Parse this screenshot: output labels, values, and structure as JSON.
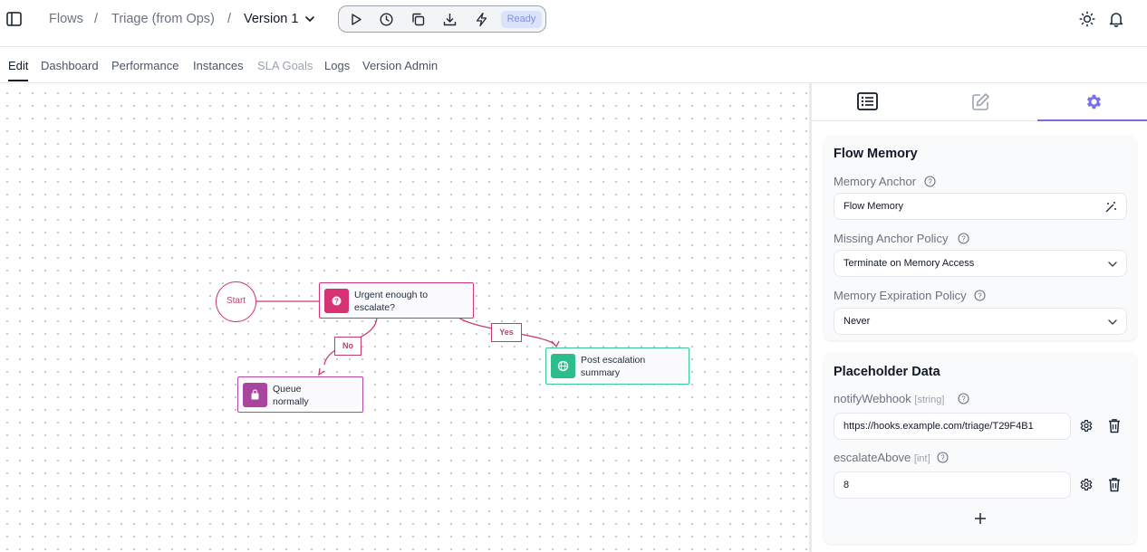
{
  "breadcrumb": {
    "root": "Flows",
    "separator": "/",
    "flow": "Triage (from Ops)",
    "version": "Version 1"
  },
  "toolbar": {
    "status": "Ready"
  },
  "tabs": [
    "Edit",
    "Dashboard",
    "Performance",
    "Instances",
    "SLA Goals",
    "Logs",
    "Version Admin"
  ],
  "canvas": {
    "start_label": "Start",
    "nodes": {
      "decision": "Urgent enough to escalate?",
      "queue": "Queue normally",
      "post": "Post escalation summary"
    },
    "edges": {
      "no": "No",
      "yes": "Yes"
    }
  },
  "panel": {
    "flow_memory": {
      "title": "Flow Memory",
      "anchor_label": "Memory Anchor",
      "anchor_value": "Flow Memory",
      "missing_label": "Missing Anchor Policy",
      "missing_value": "Terminate on Memory Access",
      "expiration_label": "Memory Expiration Policy",
      "expiration_value": "Never"
    },
    "placeholder_data": {
      "title": "Placeholder Data",
      "items": [
        {
          "name": "notifyWebhook",
          "type": "[string]",
          "value": "https://hooks.example.com/triage/T29F4B1"
        },
        {
          "name": "escalateAbove",
          "type": "[int]",
          "value": "8"
        }
      ]
    }
  },
  "colors": {
    "accent_pink": "#c73a6e",
    "decision_badge": "#d63374",
    "queue_badge": "#a9449f",
    "post_badge": "#2bbd8c",
    "panel_accent": "#7c6fe6"
  },
  "icons": [
    "sidebar-toggle-icon",
    "chevron-down-icon",
    "play-icon",
    "history-icon",
    "copy-icon",
    "download-icon",
    "lightning-icon",
    "sun-icon",
    "bell-icon",
    "list-icon",
    "edit-icon",
    "gear-icon",
    "help-icon",
    "magic-wand-icon",
    "trash-icon",
    "plus-icon",
    "question-icon",
    "bag-icon",
    "globe-icon"
  ]
}
